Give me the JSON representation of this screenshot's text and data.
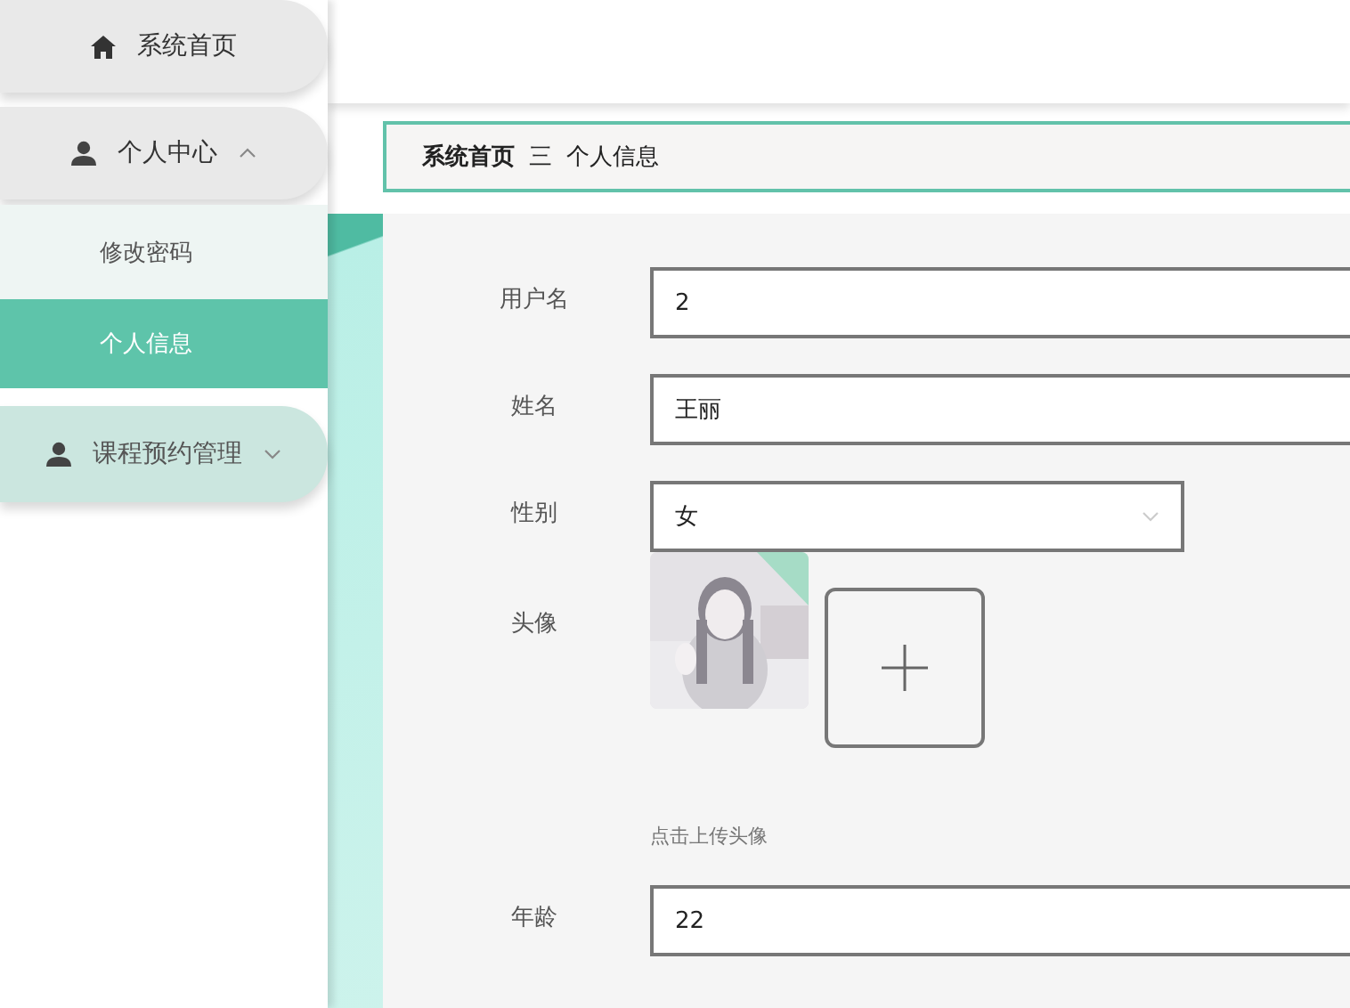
{
  "sidebar": {
    "items": [
      {
        "kind": "link",
        "label": "系统首页"
      },
      {
        "kind": "group",
        "label": "个人中心",
        "expanded": true,
        "children": [
          {
            "label": "修改密码",
            "selected": false
          },
          {
            "label": "个人信息",
            "selected": true
          }
        ]
      },
      {
        "kind": "group",
        "label": "课程预约管理",
        "expanded": false
      }
    ]
  },
  "breadcrumb": {
    "items": [
      "系统首页",
      "个人信息"
    ],
    "separator": "三"
  },
  "form": {
    "fields": [
      {
        "kind": "text",
        "label": "用户名",
        "value": "2"
      },
      {
        "kind": "text",
        "label": "姓名",
        "value": "王丽"
      },
      {
        "kind": "select",
        "label": "性别",
        "value": "女"
      },
      {
        "kind": "upload",
        "label": "头像",
        "hint": "点击上传头像"
      },
      {
        "kind": "text",
        "label": "年龄",
        "value": "22"
      }
    ]
  }
}
